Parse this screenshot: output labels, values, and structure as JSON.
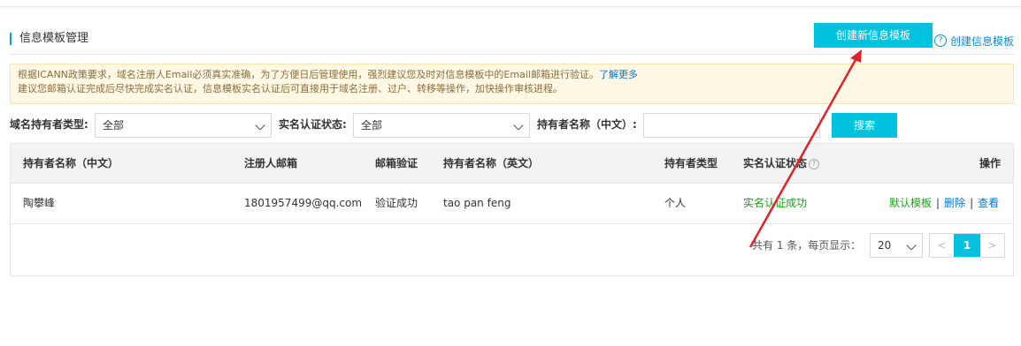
{
  "header": {
    "title": "信息模板管理",
    "create_button": "创建新信息模板",
    "help_link": "创建信息模板",
    "help_icon": "?"
  },
  "notice": {
    "line1": "根据ICANN政策要求，域名注册人Email必须真实准确，为了方便日后管理使用，强烈建议您及时对信息模板中的Email邮箱进行验证。",
    "learn_more": "了解更多",
    "line2": "建议您邮箱认证完成后尽快完成实名认证，信息模板实名认证后可直接用于域名注册、过户、转移等操作，加快操作审核进程。"
  },
  "filters": {
    "holder_type_label": "域名持有者类型:",
    "holder_type_value": "全部",
    "verify_status_label": "实名认证状态:",
    "verify_status_value": "全部",
    "holder_name_label": "持有者名称（中文）:",
    "holder_name_value": "",
    "search_button": "搜索"
  },
  "table": {
    "columns": [
      "持有者名称（中文）",
      "注册人邮箱",
      "邮箱验证",
      "持有者名称（英文）",
      "持有者类型",
      "实名认证状态",
      "操作"
    ],
    "rows": [
      {
        "name_cn": "陶攀峰",
        "email": "1801957499@qq.com",
        "email_verify": "验证成功",
        "name_en": "tao pan feng",
        "holder_type": "个人",
        "real_name_status": "实名认证成功",
        "actions": {
          "default": "默认模板",
          "delete": "删除",
          "view": "查看",
          "separator": "|"
        }
      }
    ]
  },
  "pagination": {
    "summary": "共有 1 条，每页显示：",
    "page_size": "20",
    "prev": "<",
    "current": "1",
    "next": ">"
  },
  "colors": {
    "accent": "#00c1de",
    "success": "#1aa31a",
    "link": "#0a73c9",
    "annotation_arrow": "#e0222b"
  }
}
